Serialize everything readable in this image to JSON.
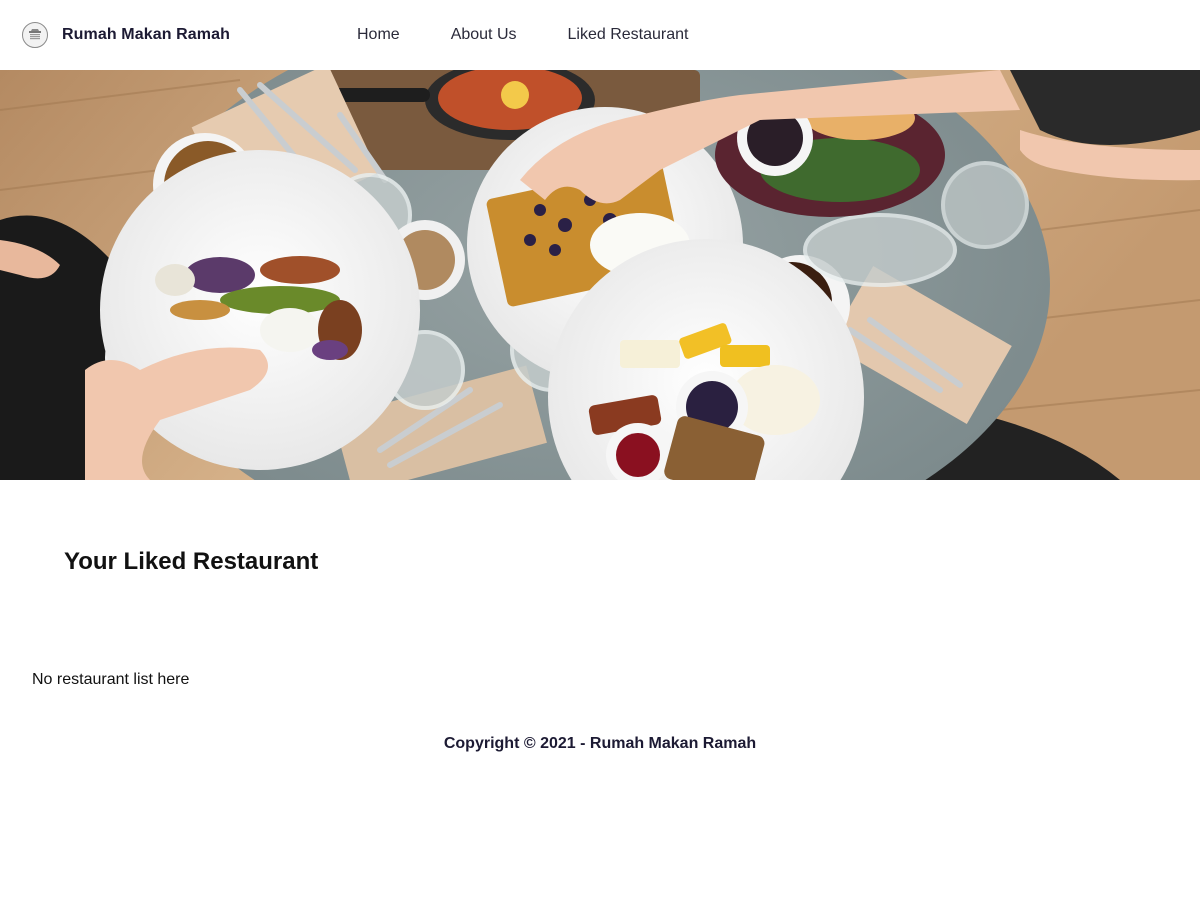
{
  "header": {
    "brand_name": "Rumah Makan Ramah",
    "logo_icon": "restaurant-logo-icon",
    "nav": [
      {
        "label": "Home"
      },
      {
        "label": "About Us"
      },
      {
        "label": "Liked Restaurant"
      }
    ]
  },
  "hero": {
    "image": "food-table-hero-image"
  },
  "main": {
    "title": "Your Liked Restaurant",
    "empty_message": "No restaurant list here"
  },
  "footer": {
    "copyright": "Copyright © 2021 - Rumah Makan Ramah"
  }
}
